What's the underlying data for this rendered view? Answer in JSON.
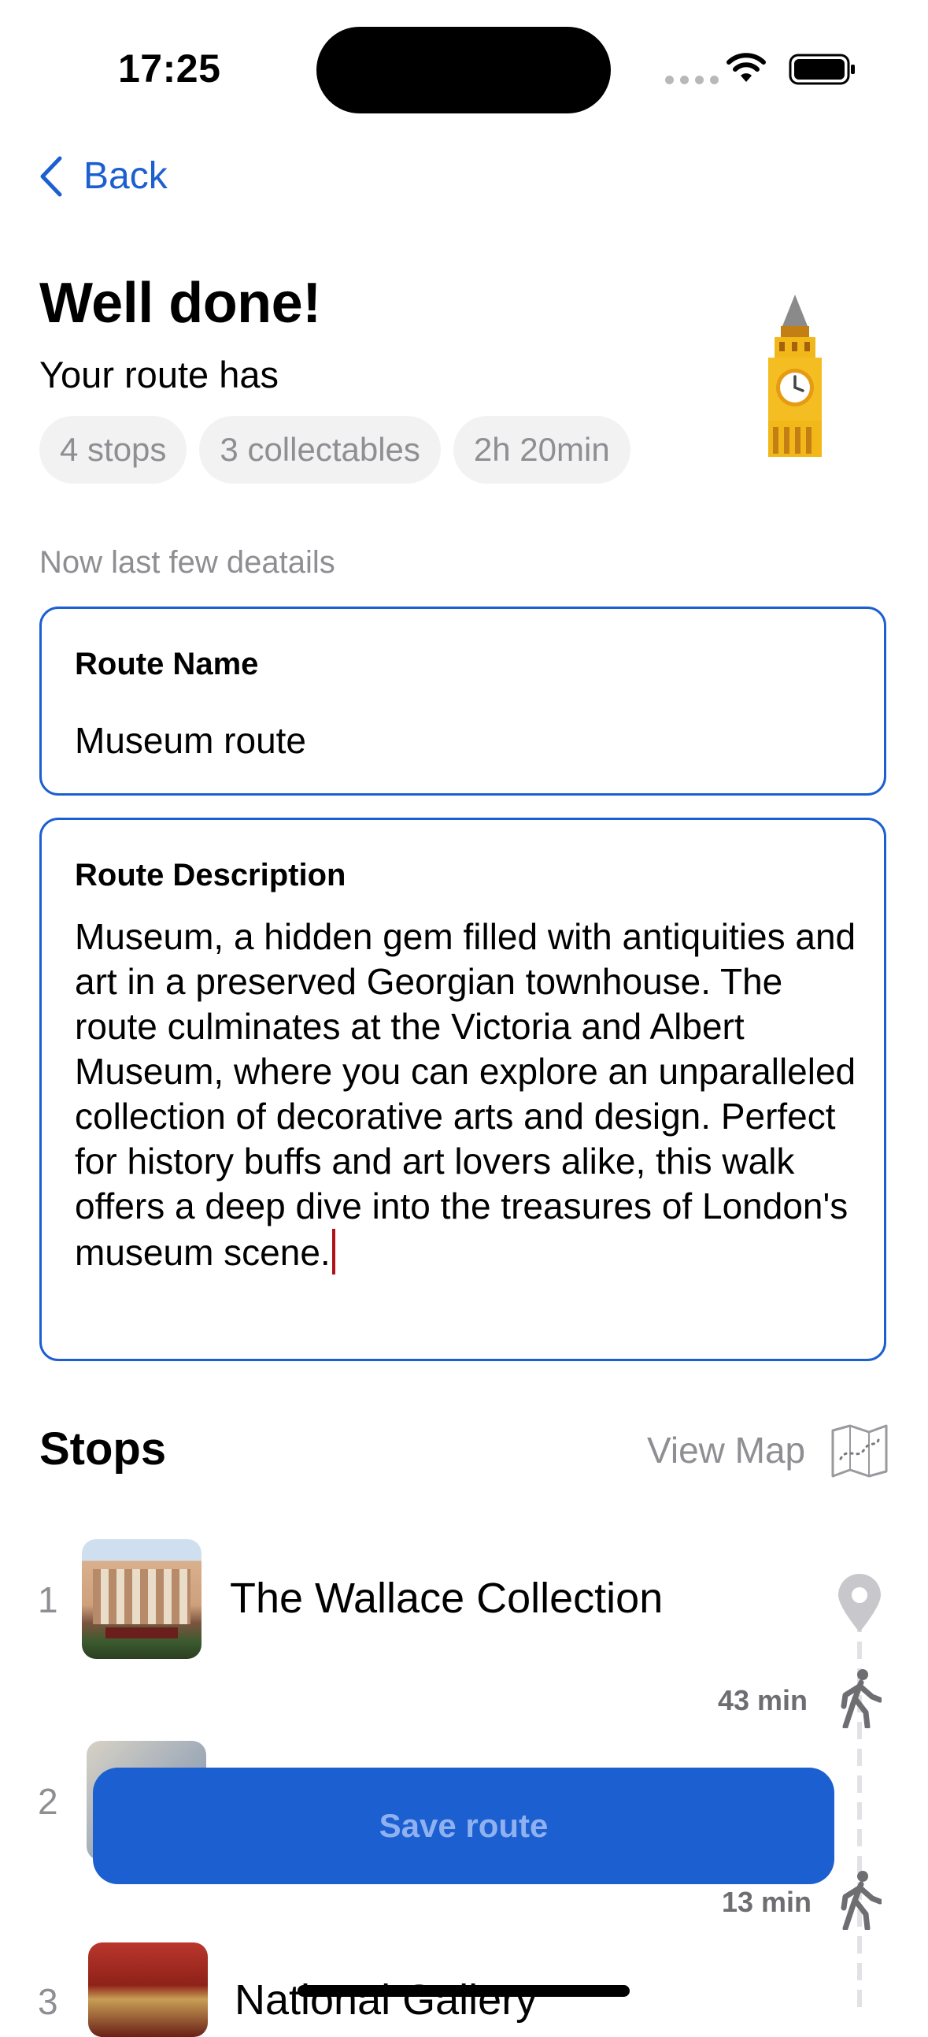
{
  "status": {
    "time": "17:25"
  },
  "nav": {
    "back_label": "Back"
  },
  "header": {
    "title": "Well done!",
    "subtitle": "Your route has",
    "chips": [
      "4 stops",
      "3 collectables",
      "2h 20min"
    ]
  },
  "form": {
    "hint": "Now last few deatails",
    "name_label": "Route Name",
    "name_value": "Museum route",
    "description_label": "Route Description",
    "description_value": "Museum, a hidden gem filled with antiquities and art in a preserved Georgian townhouse. The route culminates at the Victoria and Albert Museum, where you can explore an unparalleled collection of decorative arts and design. Perfect for history buffs and art lovers alike, this walk offers a deep dive into the treasures of London's museum scene."
  },
  "stops_section": {
    "title": "Stops",
    "view_map_label": "View Map",
    "stops": [
      {
        "number": "1",
        "name": "The Wallace Collection",
        "walk_time": "43 min"
      },
      {
        "number": "2",
        "name": "",
        "walk_time": "13 min"
      },
      {
        "number": "3",
        "name": "National Gallery",
        "walk_time": ""
      }
    ]
  },
  "actions": {
    "save_label": "Save route"
  },
  "colors": {
    "accent": "#1c5fd0",
    "chip_bg": "#f2f2f2",
    "muted": "#8e8e93"
  }
}
